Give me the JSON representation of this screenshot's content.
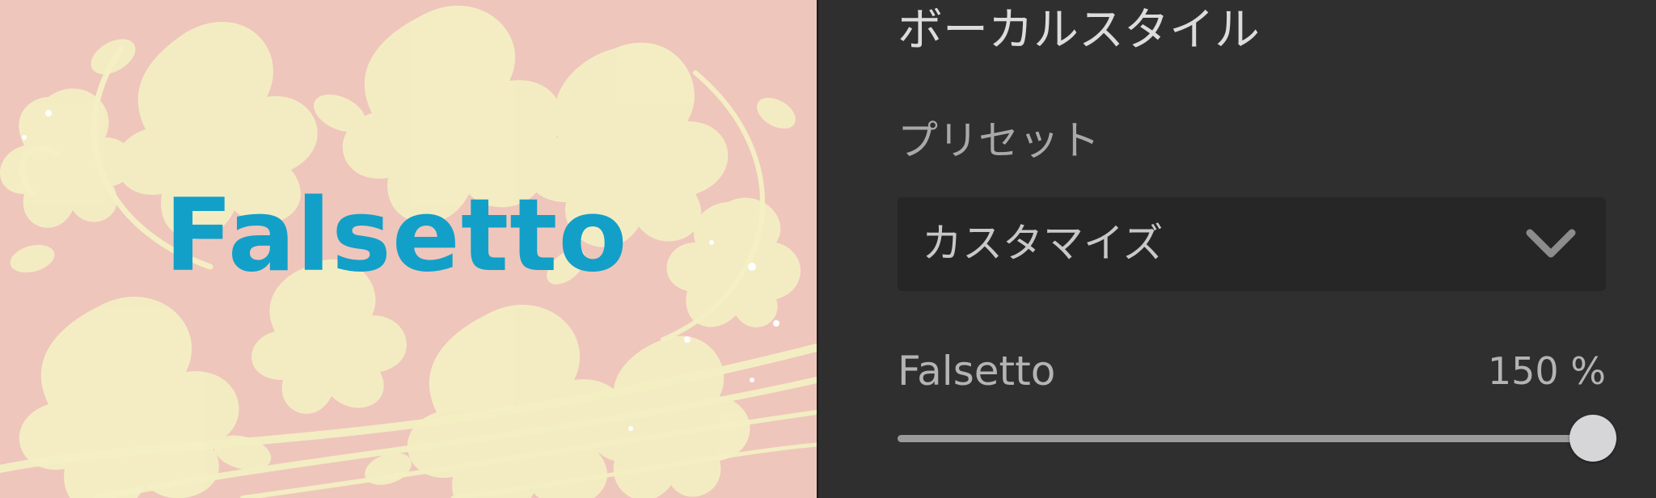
{
  "artwork": {
    "title": "Falsetto",
    "title_color": "#12a0c8",
    "background_color": "#efc6bb",
    "pattern_color": "#f4f0c4",
    "pattern_icon": "floral-pattern-icon"
  },
  "panel": {
    "section_title": "ボーカルスタイル",
    "preset": {
      "label": "プリセット",
      "selected": "カスタマイズ",
      "chevron_icon": "chevron-down-icon"
    },
    "parameter": {
      "label": "Falsetto",
      "value_text": "150 %",
      "value_fraction": 1.0
    },
    "accent_color": "#9b9b9b"
  }
}
